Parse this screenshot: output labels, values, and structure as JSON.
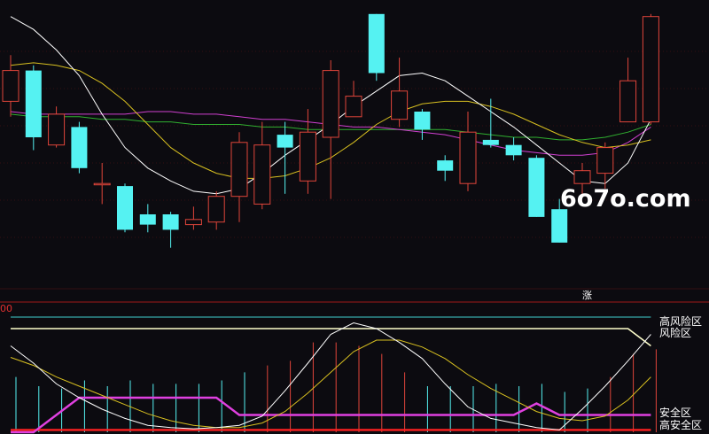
{
  "watermark": "6o7o.com",
  "badge_text": "涨",
  "lower_axis_label": "00",
  "zone_labels": {
    "top_cut": "高风险区",
    "risk": "风险区",
    "safe": "安全区",
    "high_safe": "高安全区"
  },
  "colors": {
    "background": "#0c0b10",
    "up_candle": "#e0453a",
    "down_candle": "#55f2f2",
    "ma_short": "#ffffff",
    "ma_mid": "#d8c020",
    "ma_purple": "#d040d0",
    "ma_green": "#30b030",
    "risk_line": "#ffffcc",
    "safe_line": "#e040e0",
    "high_safe_line": "#ff2020",
    "top_line": "#40d0d0",
    "separator": "#a01818",
    "grid": "#5a1414"
  },
  "chart_data": [
    {
      "type": "candlestick",
      "title": "",
      "ylim": [
        0,
        100
      ],
      "candles": [
        {
          "o": 64,
          "c": 76,
          "h": 82,
          "l": 58
        },
        {
          "o": 76,
          "c": 50,
          "h": 78,
          "l": 45
        },
        {
          "o": 47,
          "c": 59,
          "h": 62,
          "l": 46
        },
        {
          "o": 54,
          "c": 38,
          "h": 56,
          "l": 36
        },
        {
          "o": 32,
          "c": 32,
          "h": 40,
          "l": 24
        },
        {
          "o": 31,
          "c": 14,
          "h": 32,
          "l": 13
        },
        {
          "o": 20,
          "c": 16,
          "h": 24,
          "l": 13
        },
        {
          "o": 20,
          "c": 14,
          "h": 21,
          "l": 7
        },
        {
          "o": 16,
          "c": 18,
          "h": 23,
          "l": 14
        },
        {
          "o": 17,
          "c": 27,
          "h": 29,
          "l": 14
        },
        {
          "o": 27,
          "c": 48,
          "h": 52,
          "l": 17
        },
        {
          "o": 24,
          "c": 47,
          "h": 56,
          "l": 22
        },
        {
          "o": 51,
          "c": 46,
          "h": 56,
          "l": 28
        },
        {
          "o": 33,
          "c": 52,
          "h": 61,
          "l": 28
        },
        {
          "o": 50,
          "c": 76,
          "h": 80,
          "l": 26
        },
        {
          "o": 58,
          "c": 66,
          "h": 72,
          "l": 58
        },
        {
          "o": 98,
          "c": 75,
          "h": 98,
          "l": 72
        },
        {
          "o": 57,
          "c": 68,
          "h": 81,
          "l": 54
        },
        {
          "o": 60,
          "c": 53,
          "h": 61,
          "l": 49
        },
        {
          "o": 41,
          "c": 37,
          "h": 43,
          "l": 33
        },
        {
          "o": 32,
          "c": 52,
          "h": 60,
          "l": 29
        },
        {
          "o": 49,
          "c": 47,
          "h": 65,
          "l": 46
        },
        {
          "o": 47,
          "c": 43,
          "h": 50,
          "l": 41
        },
        {
          "o": 42,
          "c": 19,
          "h": 43,
          "l": 19
        },
        {
          "o": 22,
          "c": 9,
          "h": 26,
          "l": 9
        },
        {
          "o": 32,
          "c": 37,
          "h": 40,
          "l": 28
        },
        {
          "o": 36,
          "c": 46,
          "h": 48,
          "l": 30
        },
        {
          "o": 56,
          "c": 72,
          "h": 81,
          "l": 56
        },
        {
          "o": 56,
          "c": 97,
          "h": 98,
          "l": 55
        }
      ],
      "ma_short": [
        97,
        92,
        84,
        74,
        59,
        46,
        38,
        33,
        29,
        28,
        30,
        36,
        43,
        49,
        55,
        62,
        68,
        74,
        75,
        72,
        66,
        60,
        54,
        47,
        40,
        33,
        32,
        40,
        57
      ],
      "ma_mid": [
        78,
        79,
        78,
        76,
        71,
        64,
        55,
        46,
        40,
        36,
        34,
        34,
        35,
        38,
        42,
        48,
        55,
        60,
        63,
        64,
        64,
        62,
        59,
        55,
        51,
        48,
        46,
        47,
        49
      ],
      "ma_purple": [
        60,
        59,
        59,
        59,
        59,
        59,
        60,
        60,
        59,
        59,
        58,
        57,
        57,
        56,
        55,
        54,
        54,
        53,
        52,
        51,
        49,
        47,
        45,
        44,
        43,
        43,
        44,
        48,
        54
      ],
      "ma_green": [
        59,
        58,
        58,
        58,
        57,
        57,
        56,
        56,
        55,
        55,
        55,
        54,
        54,
        53,
        53,
        53,
        53,
        53,
        53,
        53,
        52,
        51,
        50,
        50,
        49,
        49,
        50,
        52,
        55
      ]
    },
    {
      "type": "line",
      "title": "",
      "ylim": [
        0,
        100
      ],
      "series": [
        {
          "values": [
            75,
            60,
            42,
            30,
            20,
            12,
            6,
            4,
            3,
            4,
            6,
            14,
            36,
            60,
            85,
            95,
            90,
            78,
            64,
            42,
            22,
            12,
            8,
            4,
            2,
            20,
            40,
            62,
            85
          ]
        },
        {
          "values": [
            65,
            58,
            48,
            40,
            32,
            24,
            16,
            10,
            6,
            4,
            4,
            8,
            18,
            34,
            52,
            70,
            80,
            80,
            74,
            64,
            50,
            38,
            28,
            18,
            12,
            10,
            14,
            28,
            48
          ]
        },
        {
          "values": [
            0,
            0,
            15,
            30,
            30,
            30,
            30,
            30,
            30,
            30,
            15,
            15,
            15,
            15,
            15,
            15,
            15,
            15,
            15,
            15,
            15,
            15,
            15,
            25,
            15,
            15,
            15,
            15,
            15
          ]
        },
        {
          "values": [
            90,
            90,
            90,
            90,
            90,
            90,
            90,
            90,
            90,
            90,
            90,
            90,
            90,
            90,
            90,
            90,
            90,
            90,
            90,
            90,
            90,
            90,
            90,
            90,
            90,
            90,
            90,
            90,
            75
          ]
        },
        {
          "values": [
            100,
            100,
            100,
            100,
            100,
            100,
            100,
            100,
            100,
            100,
            100,
            100,
            100,
            100,
            100,
            100,
            100,
            100,
            100,
            100,
            100,
            100,
            100,
            100,
            100,
            100,
            100,
            100,
            100
          ]
        },
        {
          "values": [
            2,
            2,
            2,
            2,
            2,
            2,
            2,
            2,
            2,
            2,
            2,
            2,
            2,
            2,
            2,
            2,
            2,
            2,
            2,
            2,
            2,
            2,
            2,
            2,
            2,
            2,
            2,
            2,
            2
          ]
        }
      ],
      "bars": [
        {
          "v": 48,
          "dir": "down"
        },
        {
          "v": 40,
          "dir": "down"
        },
        {
          "v": 38,
          "dir": "down"
        },
        {
          "v": 45,
          "dir": "down"
        },
        {
          "v": 40,
          "dir": "down"
        },
        {
          "v": 45,
          "dir": "down"
        },
        {
          "v": 42,
          "dir": "down"
        },
        {
          "v": 42,
          "dir": "down"
        },
        {
          "v": 42,
          "dir": "down"
        },
        {
          "v": 45,
          "dir": "down"
        },
        {
          "v": 52,
          "dir": "down"
        },
        {
          "v": 58,
          "dir": "up"
        },
        {
          "v": 62,
          "dir": "up"
        },
        {
          "v": 78,
          "dir": "up"
        },
        {
          "v": 78,
          "dir": "up"
        },
        {
          "v": 75,
          "dir": "up"
        },
        {
          "v": 68,
          "dir": "up"
        },
        {
          "v": 52,
          "dir": "up"
        },
        {
          "v": 40,
          "dir": "down"
        },
        {
          "v": 40,
          "dir": "down"
        },
        {
          "v": 40,
          "dir": "down"
        },
        {
          "v": 42,
          "dir": "down"
        },
        {
          "v": 40,
          "dir": "down"
        },
        {
          "v": 42,
          "dir": "down"
        },
        {
          "v": 35,
          "dir": "down"
        },
        {
          "v": 38,
          "dir": "down"
        },
        {
          "v": 48,
          "dir": "up"
        },
        {
          "v": 68,
          "dir": "up"
        },
        {
          "v": 72,
          "dir": "up"
        }
      ]
    }
  ]
}
